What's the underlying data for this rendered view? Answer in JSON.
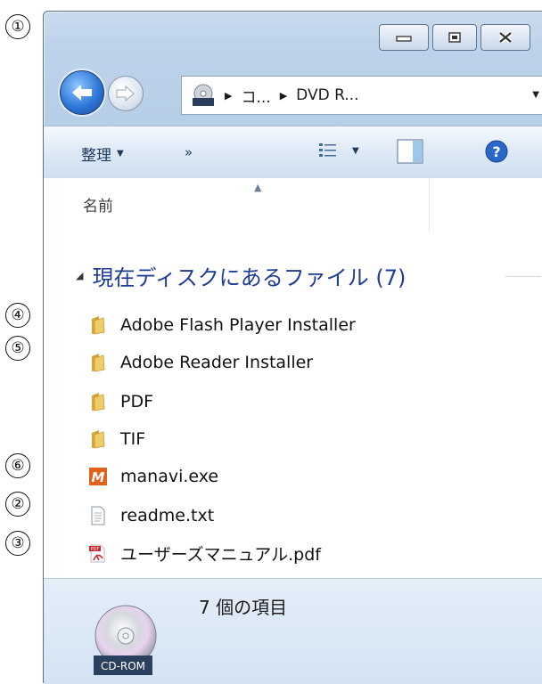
{
  "markers": {
    "m1": "①",
    "m2": "②",
    "m3": "③",
    "m4": "④",
    "m5": "⑤",
    "m6": "⑥"
  },
  "window": {
    "caption_buttons": [
      "minimize-icon",
      "maximize-icon",
      "close-icon"
    ]
  },
  "address_bar": {
    "segment_1": "コ...",
    "segment_2": "DVD R...",
    "drive_icon_label": "CD-ROM"
  },
  "command_bar": {
    "organize_label": "整理",
    "more_label": "»"
  },
  "file_list": {
    "column_name": "名前",
    "group_label": "現在ディスクにあるファイル (7)",
    "items": [
      {
        "name": "Adobe Flash Player Installer",
        "icon": "folder-icon"
      },
      {
        "name": "Adobe Reader Installer",
        "icon": "folder-icon"
      },
      {
        "name": "PDF",
        "icon": "folder-icon"
      },
      {
        "name": "TIF",
        "icon": "folder-icon"
      },
      {
        "name": "manavi.exe",
        "icon": "manavi-exe-icon",
        "icon_glyph": "M"
      },
      {
        "name": "readme.txt",
        "icon": "text-file-icon"
      },
      {
        "name": "ユーザーズマニュアル.pdf",
        "icon": "pdf-file-icon",
        "icon_glyph": "PDF"
      }
    ]
  },
  "details_pane": {
    "item_count": "7 個の項目",
    "drive_label": "CD-ROM"
  },
  "colors": {
    "group_header": "#1e3c96",
    "window_frame": "#bdd3ea",
    "folder": "#e8b94a",
    "manavi_icon": "#e0621c",
    "pdf_icon": "#c8282a"
  }
}
